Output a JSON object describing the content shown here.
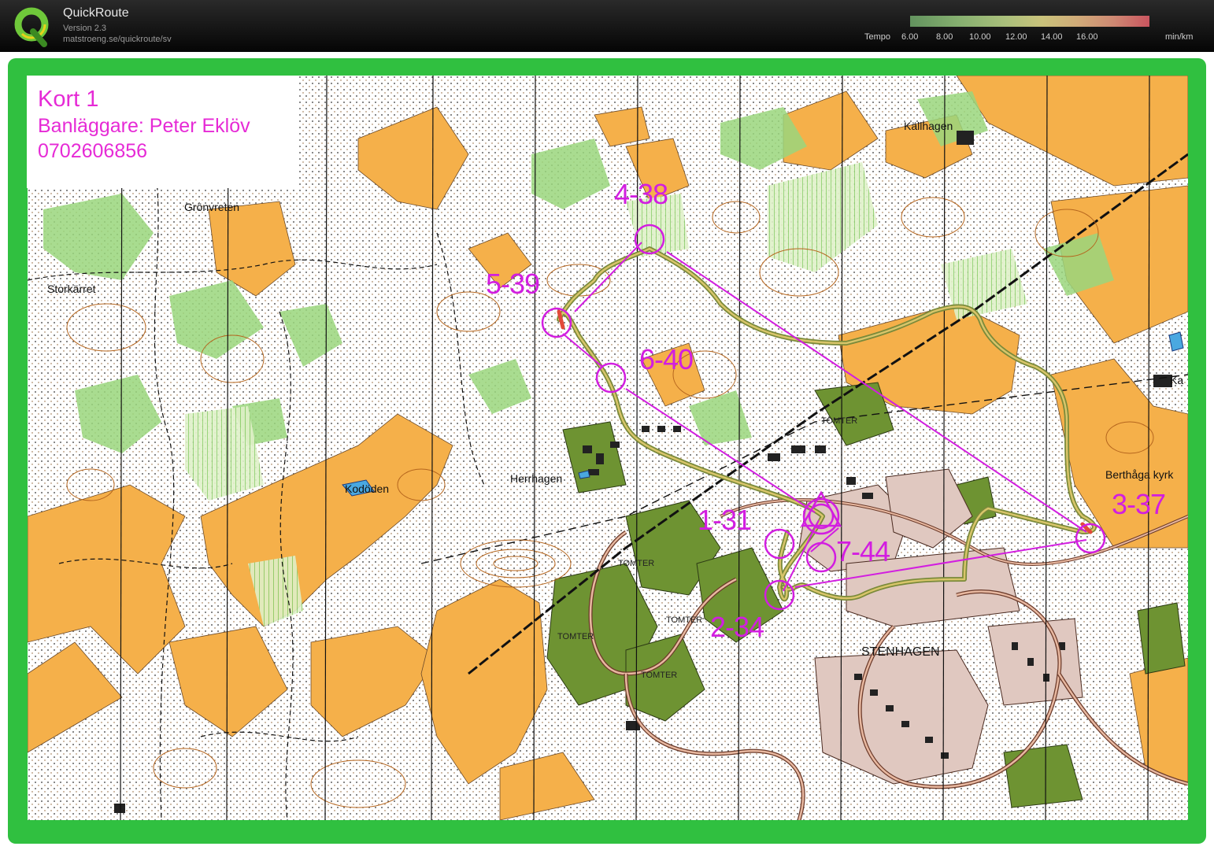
{
  "app": {
    "title": "QuickRoute",
    "version": "Version 2.3",
    "url": "matstroeng.se/quickroute/sv",
    "logo_icon": "quickroute-q-logo-icon"
  },
  "legend": {
    "label": "Tempo",
    "ticks": [
      "6.00",
      "8.00",
      "10.00",
      "12.00",
      "14.00",
      "16.00"
    ],
    "unit": "min/km"
  },
  "course": {
    "name": "Kort 1",
    "setter": "Banläggare: Peter Eklöv",
    "phone": "0702606856"
  },
  "place_names": {
    "gronvreten": "Grönvreten",
    "storkarret": "Storkärret",
    "kododen": "Kodöden",
    "herrhagen": "Herrhagen",
    "kallhagen": "Källhagen",
    "berthaga": "Berthåga kyrk",
    "stenhagen": "STENHAGEN",
    "tomter": "TOMTER",
    "ka": "Ka"
  },
  "controls": [
    {
      "label": "1-31"
    },
    {
      "label": "2-34"
    },
    {
      "label": "3-37"
    },
    {
      "label": "4-38"
    },
    {
      "label": "5-39"
    },
    {
      "label": "6-40"
    },
    {
      "label": "7-44"
    }
  ],
  "colors": {
    "frame": "#30c040",
    "course": "#d21ee0",
    "route": "#b8b85a",
    "open_land": "#f5b04a",
    "forest_green": "#8fcf6f",
    "built_up": "#6b8f2a"
  }
}
